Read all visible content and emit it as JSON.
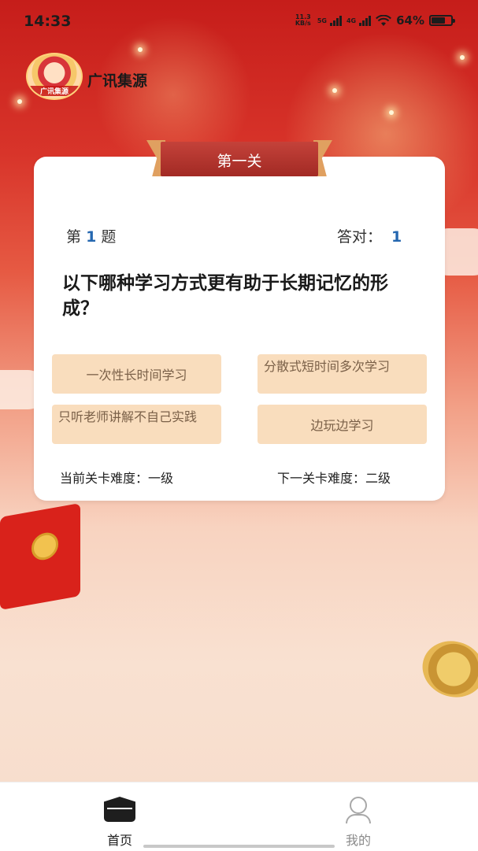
{
  "status_bar": {
    "time": "14:33",
    "net_speed_value": "11.3",
    "net_speed_unit": "KB/s",
    "sim1_type": "5G",
    "sim2_type": "4G",
    "battery_percent": "64%",
    "battery_level": 0.64
  },
  "app": {
    "name": "广讯集源",
    "avatar_label": "广讯集源"
  },
  "quiz": {
    "level_title": "第一关",
    "question_prefix": "第",
    "question_number": "1",
    "question_suffix": "题",
    "correct_label": "答对：",
    "correct_count": "1",
    "question_text": "以下哪种学习方式更有助于长期记忆的形成？",
    "options": [
      "一次性长时间学习",
      "分散式短时间多次学习",
      "只听老师讲解不自己实践",
      "边玩边学习"
    ],
    "current_difficulty": "当前关卡难度：一级",
    "next_difficulty": "下一关卡难度：二级"
  },
  "bottom_nav": {
    "items": [
      {
        "label": "首页",
        "icon": "home-icon",
        "active": true
      },
      {
        "label": "我的",
        "icon": "profile-icon",
        "active": false
      }
    ]
  },
  "colors": {
    "accent_blue": "#2567b0",
    "option_bg": "#f9ddbd",
    "banner_red": "#b2332c",
    "active_nav": "#1e1e1e",
    "inactive_nav": "#8a8a8a"
  }
}
